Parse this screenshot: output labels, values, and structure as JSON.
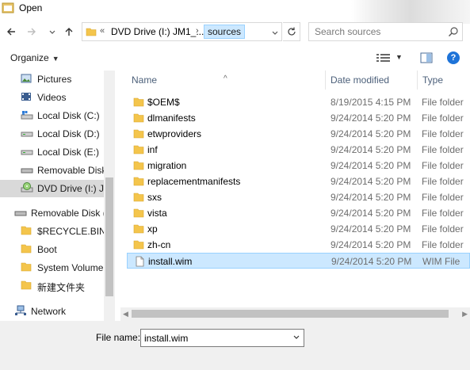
{
  "window": {
    "title": "Open"
  },
  "address": {
    "prefix": "«",
    "crumb1": "DVD Drive (I:) JM1_...",
    "crumb2": "sources"
  },
  "search": {
    "placeholder": "Search sources"
  },
  "toolbar": {
    "organize_label": "Organize"
  },
  "nav": {
    "items": [
      {
        "label": "Pictures",
        "icon": "pictures-icon"
      },
      {
        "label": "Videos",
        "icon": "videos-icon"
      },
      {
        "label": "Local Disk (C:)",
        "icon": "system-drive-icon"
      },
      {
        "label": "Local Disk (D:)",
        "icon": "drive-icon"
      },
      {
        "label": "Local Disk (E:)",
        "icon": "drive-icon"
      },
      {
        "label": "Removable Disk",
        "icon": "removable-drive-icon"
      },
      {
        "label": "DVD Drive (I:) JM",
        "icon": "dvd-drive-icon"
      },
      {
        "label": "Removable Disk (F",
        "icon": "removable-drive-icon"
      },
      {
        "label": "$RECYCLE.BIN",
        "icon": "folder-icon"
      },
      {
        "label": "Boot",
        "icon": "folder-icon"
      },
      {
        "label": "System Volume I",
        "icon": "folder-icon"
      },
      {
        "label": "新建文件夹",
        "icon": "folder-icon"
      },
      {
        "label": "Network",
        "icon": "network-icon"
      }
    ]
  },
  "columns": {
    "name": "Name",
    "date": "Date modified",
    "type": "Type"
  },
  "files": [
    {
      "name": "$OEM$",
      "date": "8/19/2015 4:15 PM",
      "type": "File folder"
    },
    {
      "name": "dlmanifests",
      "date": "9/24/2014 5:20 PM",
      "type": "File folder"
    },
    {
      "name": "etwproviders",
      "date": "9/24/2014 5:20 PM",
      "type": "File folder"
    },
    {
      "name": "inf",
      "date": "9/24/2014 5:20 PM",
      "type": "File folder"
    },
    {
      "name": "migration",
      "date": "9/24/2014 5:20 PM",
      "type": "File folder"
    },
    {
      "name": "replacementmanifests",
      "date": "9/24/2014 5:20 PM",
      "type": "File folder"
    },
    {
      "name": "sxs",
      "date": "9/24/2014 5:20 PM",
      "type": "File folder"
    },
    {
      "name": "vista",
      "date": "9/24/2014 5:20 PM",
      "type": "File folder"
    },
    {
      "name": "xp",
      "date": "9/24/2014 5:20 PM",
      "type": "File folder"
    },
    {
      "name": "zh-cn",
      "date": "9/24/2014 5:20 PM",
      "type": "File folder"
    },
    {
      "name": "install.wim",
      "date": "9/24/2014 5:20 PM",
      "type": "WIM File"
    }
  ],
  "bottom": {
    "filename_label": "File name:",
    "filename_value": "install.wim"
  },
  "colors": {
    "accent": "#1e73d8",
    "selection": "#cce8ff",
    "folder": "#f4c54c"
  }
}
